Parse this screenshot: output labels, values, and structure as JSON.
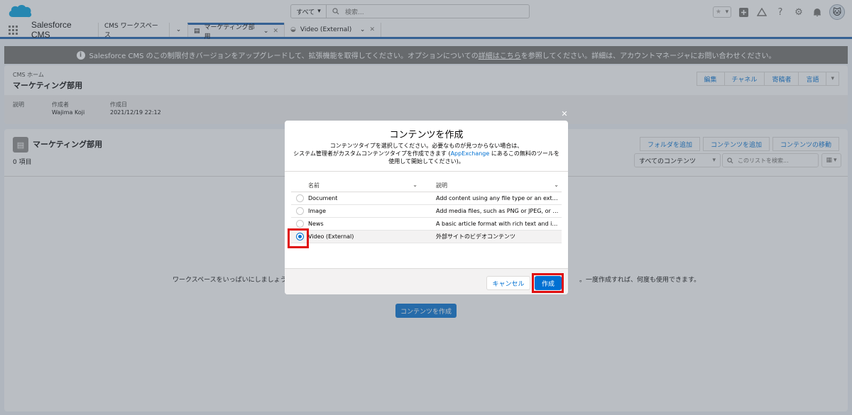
{
  "header": {
    "search_scope": "すべて",
    "search_placeholder": "検索..."
  },
  "nav": {
    "app_name": "Salesforce CMS",
    "tabs": [
      {
        "label": "CMS ワークスペース"
      },
      {
        "label": "マーケティング部用"
      },
      {
        "label": "Video (External)"
      }
    ]
  },
  "banner": {
    "text_before": "Salesforce CMS のこの制限付きバージョンをアップグレードして、拡張機能を取得してください。オプションについての",
    "link": "詳細はこちら",
    "text_after": "を参照してください。詳細は、アカウントマネージャにお問い合わせください。"
  },
  "workspace": {
    "breadcrumb": "CMS ホーム",
    "title": "マーケティング部用",
    "actions": [
      "編集",
      "チャネル",
      "寄稿者",
      "言語"
    ],
    "fields": [
      {
        "label": "説明",
        "value": ""
      },
      {
        "label": "作成者",
        "value": "Wajima Koji"
      },
      {
        "label": "作成日",
        "value": "2021/12/19 22:12"
      }
    ]
  },
  "content_list": {
    "title": "マーケティング部用",
    "count": "0 項目",
    "actions": [
      "フォルダを追加",
      "コンテンツを追加",
      "コンテンツの移動"
    ],
    "list_view": "すべてのコンテンツ",
    "search_placeholder": "このリストを検索...",
    "empty_left": "ワークスペースをいっぱいにしましょう。",
    "empty_right": "。一度作成すれば、何度も使用できます。",
    "create_button": "コンテンツを作成"
  },
  "modal": {
    "title": "コンテンツを作成",
    "desc_line1": "コンテンツタイプを選択してください。必要なものが見つからない場合は、",
    "desc_line2_before": "システム管理者がカスタムコンテンツタイプを作成できます (",
    "desc_link": "AppExchange",
    "desc_line2_after": " にあるこの無料のツールを",
    "desc_line3": "使用して開始してください)。",
    "columns": {
      "name": "名前",
      "desc": "説明"
    },
    "rows": [
      {
        "name": "Document",
        "desc": "Add content using any file type or an external..."
      },
      {
        "name": "Image",
        "desc": "Add media files, such as PNG or JPEG, or link ..."
      },
      {
        "name": "News",
        "desc": "A basic article format with rich text and imag..."
      },
      {
        "name": "Video (External)",
        "desc": "外部サイトのビデオコンテンツ"
      }
    ],
    "selected_row": 3,
    "cancel": "キャンセル",
    "create": "作成"
  },
  "colors": {
    "brand": "#0070d2",
    "nav_accent": "#1b5fad",
    "highlight": "#e01010",
    "banner": "#706e6b"
  }
}
